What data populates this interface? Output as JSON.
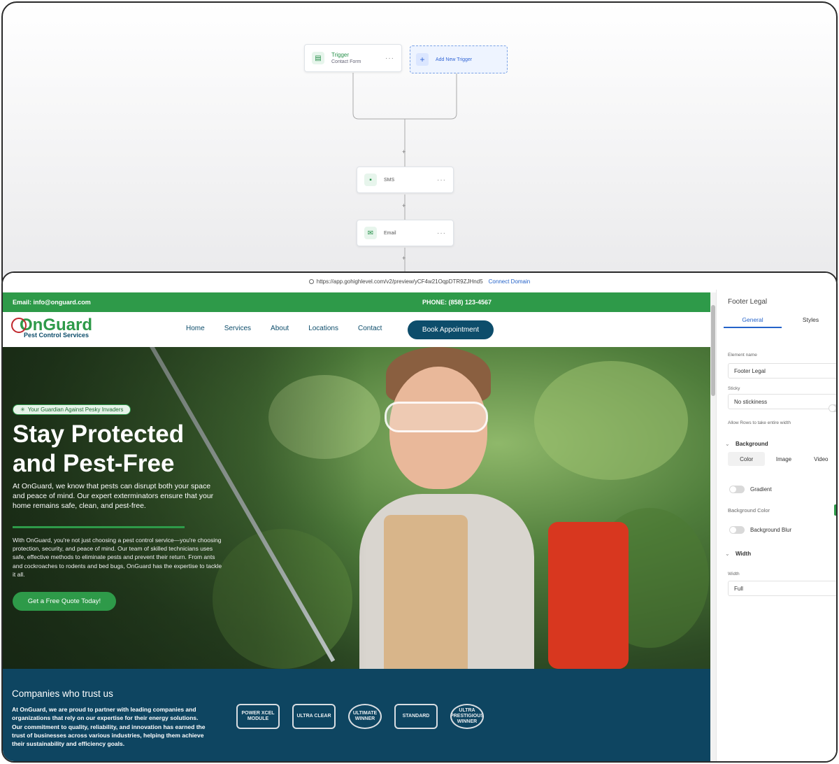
{
  "workflow": {
    "trigger": {
      "title": "Trigger",
      "subtitle": "Contact Form",
      "menu": "···"
    },
    "add_trigger": {
      "plus": "+",
      "label": "Add New Trigger"
    },
    "steps": [
      {
        "label": "SMS",
        "menu": "···"
      },
      {
        "label": "Email",
        "menu": "···"
      }
    ],
    "add_step_symbol": "+"
  },
  "browser": {
    "url": "https://app.gohighlevel.com/v2/preview/yCF4w21OqpDTR9ZJHnd5",
    "connect_domain": "Connect Domain"
  },
  "site": {
    "topbar": {
      "email": "Email: info@onguard.com",
      "phone": "PHONE: (858) 123-4567"
    },
    "logo": {
      "name": "OnGuard",
      "tagline": "Pest Control Services"
    },
    "nav": [
      "Home",
      "Services",
      "About",
      "Locations",
      "Contact"
    ],
    "book_button": "Book Appointment",
    "hero": {
      "badge": "Your Guardian Against Pesky Invaders",
      "title": "Stay Protected and Pest-Free",
      "paragraph1": "At OnGuard, we know that pests can disrupt both your space and peace of mind. Our expert exterminators ensure that your home remains safe, clean, and pest-free.",
      "paragraph2": "With OnGuard, you're not just choosing a pest control service—you're choosing protection, security, and peace of mind. Our team of skilled technicians uses safe, effective methods to eliminate pests and prevent their return. From ants and cockroaches to rodents and bed bugs, OnGuard has the expertise to tackle it all.",
      "cta": "Get a Free Quote Today!"
    },
    "trust": {
      "title": "Companies who trust us",
      "paragraph": "At OnGuard, we are proud to partner with leading companies and organizations that rely on our expertise for their energy solutions. Our commitment to quality, reliability, and innovation has earned the trust of businesses across various industries, helping them achieve their sustainability and efficiency goals.",
      "logos": [
        "POWER XCEL MODULE",
        "ULTRA CLEAR",
        "ULTIMATE WINNER",
        "STANDARD",
        "ULTRA PRESTIGIOUS WINNER"
      ]
    }
  },
  "panel": {
    "title": "Footer Legal",
    "tabs": [
      "General",
      "Styles"
    ],
    "element_name_label": "Element name",
    "element_name_value": "Footer Legal",
    "sticky_label": "Sticky",
    "sticky_value": "No stickiness",
    "allow_rows_label": "Allow Rows to take entire width",
    "background_section": "Background",
    "bg_tabs": [
      "Color",
      "Image",
      "Video"
    ],
    "gradient_label": "Gradient",
    "bg_color_label": "Background Color",
    "bg_blur_label": "Background Blur",
    "width_section": "Width",
    "width_label": "Width",
    "width_value": "Full"
  },
  "colors": {
    "brand_green": "#2e9a49",
    "brand_navy": "#0e4561",
    "link_blue": "#2563c9"
  }
}
